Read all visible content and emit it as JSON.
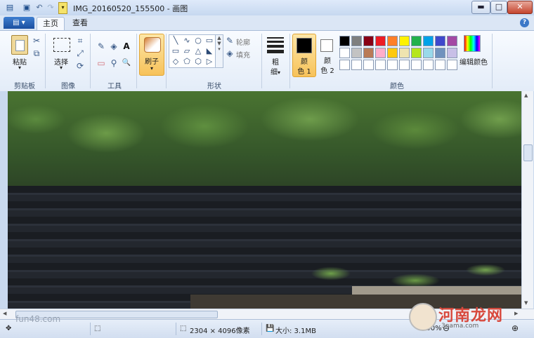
{
  "window": {
    "title": "IMG_20160520_155500 - 画图",
    "quick_access": {
      "app_icon": "paint-app-icon",
      "save_icon": "save-icon",
      "undo_icon": "undo-icon",
      "redo_icon": "redo-icon",
      "customize_icon": "chevron-down-icon"
    },
    "controls": {
      "minimize": "▬",
      "maximize": "□",
      "close": "✕"
    }
  },
  "tabs": {
    "file_menu_glyph": "▤ ▾",
    "items": [
      {
        "label": "主页",
        "active": true
      },
      {
        "label": "查看",
        "active": false
      }
    ],
    "help_glyph": "?"
  },
  "ribbon": {
    "clipboard": {
      "paste_label": "粘贴",
      "paste_arrow": "▾",
      "group_label": "剪贴板",
      "cut_icon": "✂",
      "copy_icon": "⧉"
    },
    "image": {
      "select_label": "选择",
      "select_arrow": "▾",
      "group_label": "图像",
      "crop_icon": "⌗",
      "resize_icon": "⤢",
      "rotate_icon": "⟳"
    },
    "tools": {
      "group_label": "工具",
      "pencil_icon": "✎",
      "fill_icon": "◈",
      "text_icon": "A",
      "eraser_icon": "▭",
      "picker_icon": "⚲",
      "magnifier_icon": "🔍"
    },
    "brushes": {
      "label": "刷子",
      "arrow": "▾"
    },
    "shapes": {
      "group_label": "形状",
      "glyphs": [
        "╲",
        "∿",
        "○",
        "▭",
        "▭",
        "▱",
        "△",
        "◣",
        "◇",
        "⬠",
        "⬡",
        "▷",
        "⇨",
        "⇩",
        "✚",
        "★",
        "✱",
        "💬"
      ],
      "outline_label": "轮廓",
      "fill_label": "填充"
    },
    "size": {
      "label_top": "粗",
      "label_bottom": "细",
      "arrow": "▾"
    },
    "colors": {
      "group_label": "颜色",
      "color1_label_top": "颜",
      "color1_label_bottom": "色 1",
      "color2_label_top": "颜",
      "color2_label_bottom": "色 2",
      "color1_value": "#000000",
      "color2_value": "#ffffff",
      "palette_row1": [
        "#000000",
        "#7f7f7f",
        "#880015",
        "#ed1c24",
        "#ff7f27",
        "#fff200",
        "#22b14c",
        "#00a2e8",
        "#3f48cc",
        "#a349a4"
      ],
      "palette_row2": [
        "#ffffff",
        "#c3c3c3",
        "#b97a57",
        "#ffaec9",
        "#ffc90e",
        "#efe4b0",
        "#b5e61d",
        "#99d9ea",
        "#7092be",
        "#c8bfe7"
      ],
      "palette_row3": [
        "#ffffff",
        "#ffffff",
        "#ffffff",
        "#ffffff",
        "#ffffff",
        "#ffffff",
        "#ffffff",
        "#ffffff",
        "#ffffff",
        "#ffffff"
      ],
      "edit_colors_label": "编辑颜色"
    }
  },
  "statusbar": {
    "position_icon": "✥",
    "selection_icon": "⬚",
    "dimensions_icon": "⬚",
    "dimensions": "2304 × 4096像素",
    "filesize_icon": "💾",
    "filesize": "大小: 3.1MB",
    "zoom": "100%",
    "zoom_minus": "⊖",
    "zoom_plus": "⊕"
  },
  "watermarks": {
    "left": "fun48.com",
    "right_text": "河南龙网",
    "right_url": "3nama.com"
  }
}
